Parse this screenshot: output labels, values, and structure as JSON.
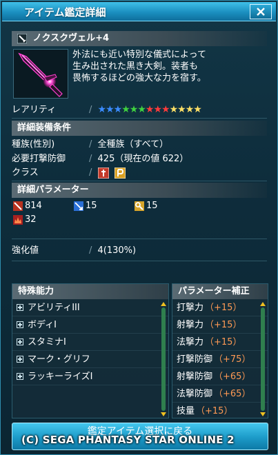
{
  "window": {
    "title": "アイテム鑑定詳細",
    "close_label": "✕"
  },
  "item": {
    "name": "ノクスクヴェル+4",
    "description_lines": [
      "外法にも近い特別な儀式によって",
      "生み出された黒き大剣。装者も",
      "畏怖するほどの強大な力を宿す。"
    ]
  },
  "rarity": {
    "label": "レアリティ",
    "stars": [
      {
        "color": "#3b8cff"
      },
      {
        "color": "#3b8cff"
      },
      {
        "color": "#3b8cff"
      },
      {
        "color": "#3fd23f"
      },
      {
        "color": "#3fd23f"
      },
      {
        "color": "#3fd23f"
      },
      {
        "color": "#ff3b3b"
      },
      {
        "color": "#ff3b3b"
      },
      {
        "color": "#ff3b3b"
      },
      {
        "color": "#ffe066"
      },
      {
        "color": "#ffe066"
      },
      {
        "color": "#ffe066"
      },
      {
        "color": "#ffe066"
      }
    ]
  },
  "equip": {
    "header": "詳細装備条件",
    "race_label": "種族(性別)",
    "race_value": "全種族（すべて）",
    "req_label": "必要打撃防御",
    "req_value": "425（現在の値 622）",
    "class_label": "クラス",
    "class_icons": [
      "hunter-class-icon",
      "phantom-class-icon"
    ]
  },
  "params": {
    "header": "詳細パラメーター",
    "stats": [
      {
        "icon": "striking-attack-icon",
        "value": "814"
      },
      {
        "icon": "ranged-attack-icon",
        "value": "15"
      },
      {
        "icon": "technique-attack-icon",
        "value": "15"
      },
      {
        "icon": "element-icon",
        "value": "32"
      }
    ],
    "grind_label": "強化値",
    "grind_value": "4(130%)"
  },
  "special": {
    "header": "特殊能力",
    "items": [
      "アビリティIII",
      "ボディI",
      "スタミナI",
      "マーク・グリフ",
      "ラッキーライズI"
    ]
  },
  "bonus": {
    "header": "パラメーター補正",
    "items": [
      {
        "label": "打撃力",
        "value": "（+15）"
      },
      {
        "label": "射撃力",
        "value": "（+15）"
      },
      {
        "label": "法撃力",
        "value": "（+15）"
      },
      {
        "label": "打撃防御",
        "value": "（+75）"
      },
      {
        "label": "射撃防御",
        "value": "（+65）"
      },
      {
        "label": "法撃防御",
        "value": "（+65）"
      },
      {
        "label": "技量",
        "value": "（+15）"
      }
    ]
  },
  "footer": {
    "button_label": "鑑定アイテム選択に戻る",
    "copyright": "(C) SEGA  PHANTASY STAR ONLINE 2"
  }
}
